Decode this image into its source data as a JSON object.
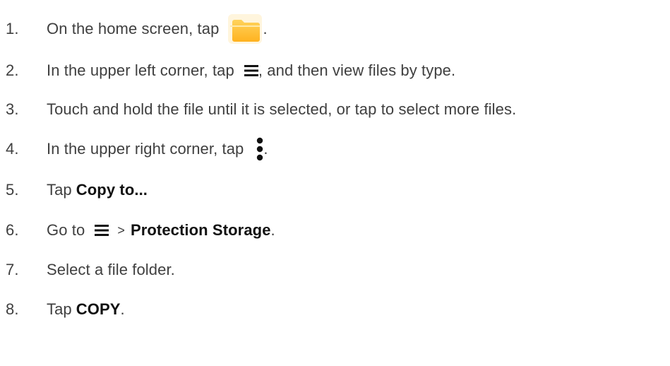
{
  "steps": [
    {
      "number": "1.",
      "text_before": "On the home screen, tap",
      "icon": "files-app-icon",
      "text_after": "."
    },
    {
      "number": "2.",
      "text_before": "In the upper left corner, tap",
      "icon": "menu-icon",
      "text_after": ", and then view files by type."
    },
    {
      "number": "3.",
      "text": "Touch and hold the file until it is selected, or tap to select more files."
    },
    {
      "number": "4.",
      "text_before": "In the upper right corner, tap",
      "icon": "more-vertical-icon",
      "text_after": "."
    },
    {
      "number": "5.",
      "text_before": "Tap",
      "bold": "Copy to..."
    },
    {
      "number": "6.",
      "text_before": "Go to",
      "icon": "menu-icon",
      "separator": ">",
      "bold": "Protection Storage",
      "text_after": "."
    },
    {
      "number": "7.",
      "text": "Select a file folder."
    },
    {
      "number": "8.",
      "text_before": "Tap",
      "bold": "COPY",
      "text_after": "."
    }
  ],
  "colors": {
    "text": "#3f3f3f",
    "emphasis": "#111111",
    "files_icon_top": "#ffd35c",
    "files_icon_bottom": "#ffb21f"
  }
}
